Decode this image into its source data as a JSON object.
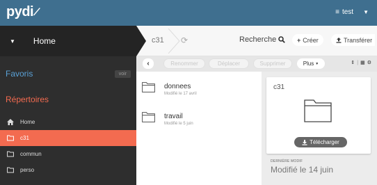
{
  "app": {
    "logo_text": "pydi",
    "user_label": "test",
    "brand_color": "#3f6f8f",
    "accent_color": "#f36b50"
  },
  "sidebar": {
    "home_label": "Home",
    "favorites_label": "Favoris",
    "voir_label": "voir",
    "repos_label": "Répertoires",
    "items": [
      {
        "label": "Home",
        "icon": "home-icon",
        "active": false
      },
      {
        "label": "c31",
        "icon": "folder-icon",
        "active": true
      },
      {
        "label": "commun",
        "icon": "folder-icon",
        "active": false
      },
      {
        "label": "perso",
        "icon": "folder-icon",
        "active": false
      }
    ]
  },
  "breadcrumb": {
    "current": "c31",
    "refresh_icon": "refresh-icon"
  },
  "header": {
    "search_label": "Recherche",
    "create_label": "Créer",
    "transfer_label": "Transférer"
  },
  "toolbar": {
    "rename_label": "Renommer",
    "move_label": "Déplacer",
    "delete_label": "Supprimer",
    "more_label": "Plus"
  },
  "files": [
    {
      "name": "donnees",
      "meta": "Modifié le 17 avril"
    },
    {
      "name": "travail",
      "meta": "Modifié le 5 juin"
    }
  ],
  "info": {
    "title": "c31",
    "download_label": "Télécharger",
    "modified_label": "DERNIÈRE MODIF",
    "modified_value": "Modifié le 14 juin"
  }
}
